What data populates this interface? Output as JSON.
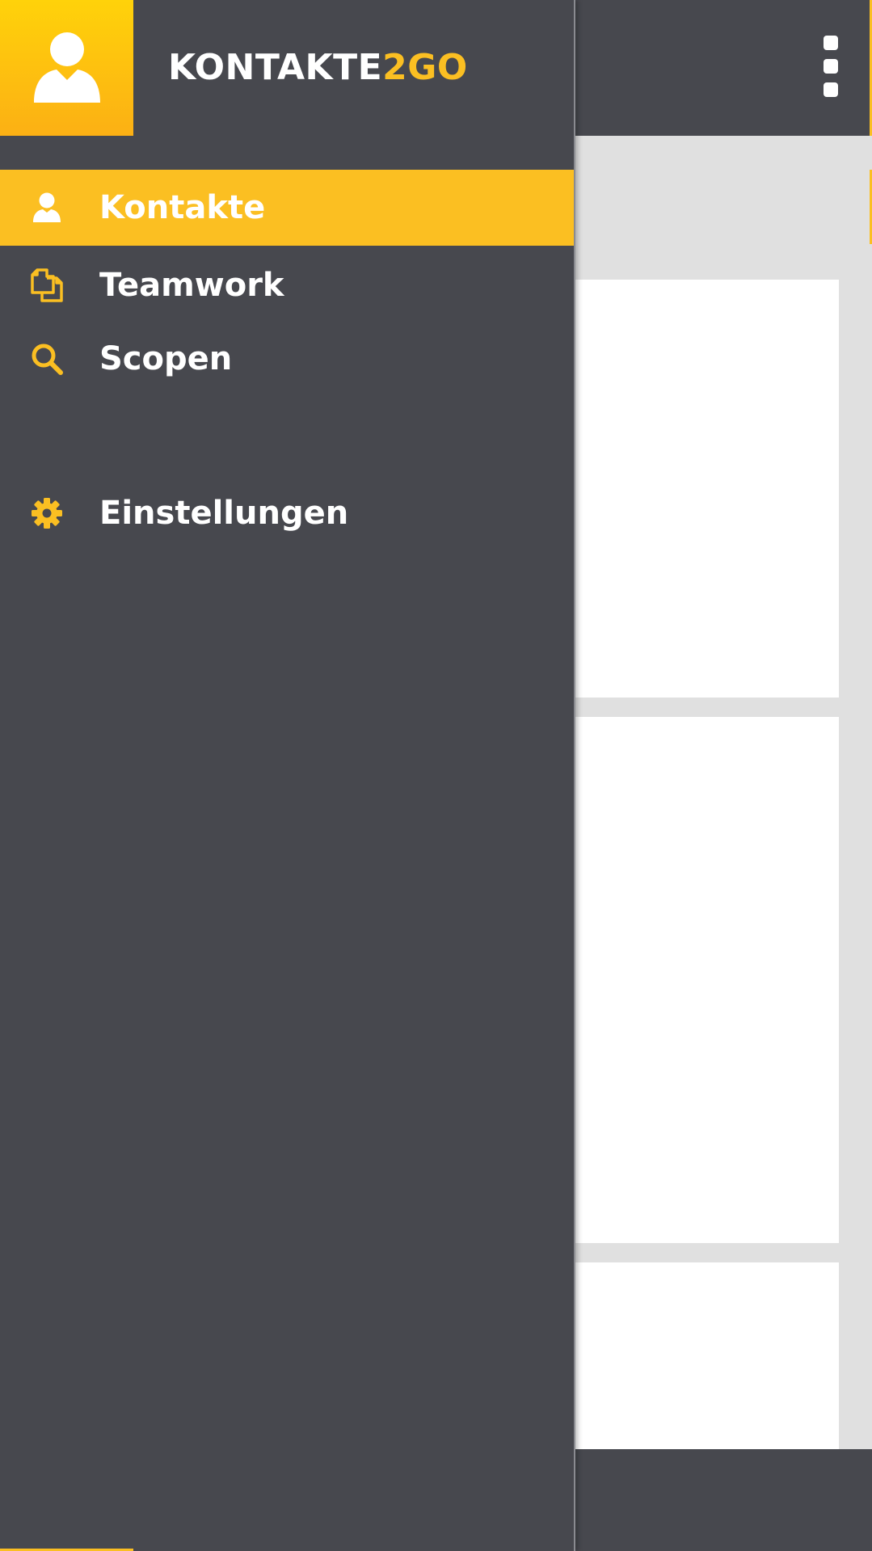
{
  "app": {
    "name_main": "KONTAKTE",
    "name_accent": "2GO"
  },
  "colors": {
    "drawer_bg": "#47484e",
    "accent": "#fbbf22",
    "content_bg": "#e0e0e0",
    "card_bg": "#ffffff"
  },
  "drawer": {
    "items": [
      {
        "label": "Kontakte",
        "icon": "person-icon",
        "active": true
      },
      {
        "label": "Teamwork",
        "icon": "documents-icon",
        "active": false
      },
      {
        "label": "Scopen",
        "icon": "search-icon",
        "active": false
      },
      {
        "label": "Einstellungen",
        "icon": "gear-icon",
        "active": false
      }
    ]
  },
  "topbar": {
    "overflow_icon": "more-vertical-icon"
  }
}
